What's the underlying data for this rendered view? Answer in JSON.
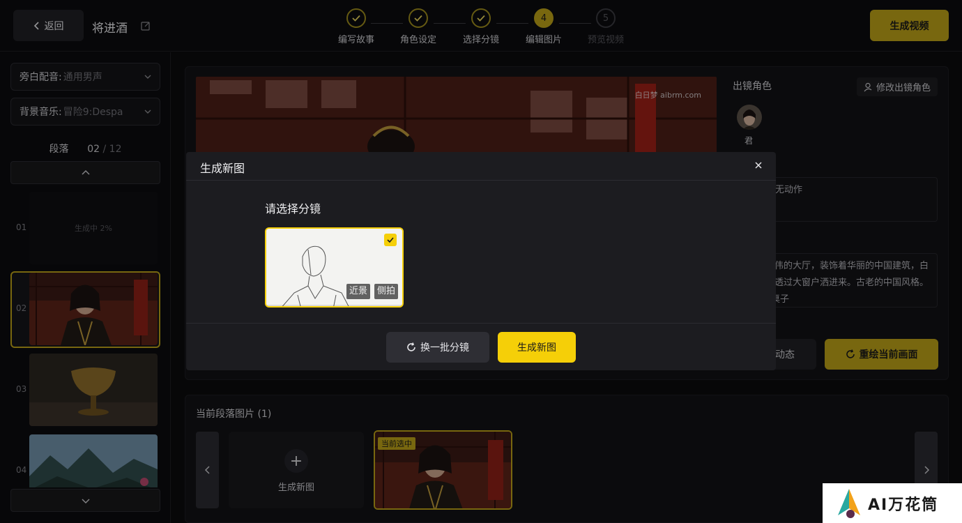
{
  "header": {
    "back_label": "返回",
    "project_title": "将进酒",
    "generate_video_label": "生成视频",
    "steps": [
      {
        "num": "1",
        "label": "编写故事",
        "state": "done"
      },
      {
        "num": "2",
        "label": "角色设定",
        "state": "done"
      },
      {
        "num": "3",
        "label": "选择分镜",
        "state": "done"
      },
      {
        "num": "4",
        "label": "编辑图片",
        "state": "active"
      },
      {
        "num": "5",
        "label": "预览视频",
        "state": "future"
      }
    ]
  },
  "sidebar": {
    "narration_key": "旁白配音:",
    "narration_value": "通用男声",
    "bgm_key": "背景音乐:",
    "bgm_value": "冒险9:Despa",
    "paragraph_label": "段落",
    "paragraph_current": "02",
    "paragraph_total": "/ 12",
    "items": [
      {
        "num": "01",
        "status": "生成中 2%"
      },
      {
        "num": "02"
      },
      {
        "num": "03"
      },
      {
        "num": "04"
      }
    ]
  },
  "main": {
    "roles_title": "出镜角色",
    "modify_roles_label": "修改出镜角色",
    "role_name": "君",
    "action_text": "无动作",
    "scene_text_line1": "伟的大厅，装饰着华丽的中国建筑，白",
    "scene_text_line2": "透过大窗户洒进来。古老的中国风格。",
    "scene_text_line3": "桌子",
    "dynamic_label": "动态",
    "redraw_label": "重绘当前画面",
    "image_watermark": "白日梦 aibrm.com"
  },
  "bottom": {
    "title": "当前段落图片 (1)",
    "new_image_label": "生成新图",
    "current_badge": "当前选中"
  },
  "modal": {
    "title": "生成新图",
    "subtitle": "请选择分镜",
    "tag_shot": "近景",
    "tag_angle": "侧拍",
    "batch_label": "换一批分镜",
    "generate_label": "生成新图"
  },
  "watermark": {
    "text": "AI万花筒"
  },
  "colors": {
    "accent": "#b89e17",
    "accent_bright": "#f5cf08",
    "background": "#0b0b0d"
  }
}
